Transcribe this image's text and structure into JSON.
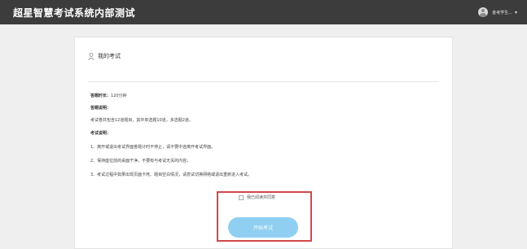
{
  "header": {
    "app_title": "超星智慧考试系统内部测试",
    "user_name": "金考学生...",
    "user_menu_icon": "chevron-down-icon",
    "avatar_icon": "user-avatar-icon"
  },
  "section": {
    "icon": "person-icon",
    "title": "我的考试"
  },
  "exam": {
    "duration_label": "答题时长：",
    "duration_value": "120分钟",
    "info_label": "答题说明：",
    "info_text": "考试卷共包含12道题目，其中单选题10道，多选题2道。",
    "notes_label": "考试说明：",
    "notes": [
      "1、离开或退出考试界面答题计时不停止，请不要中途离开考试界面。",
      "2、保持座位前的桌面干净，不要有与考试无关的内容。",
      "3、考试过程中如果出现页面卡死、题目空白情况，请尝试切换网络或退出重新进入考试。"
    ]
  },
  "agree": {
    "label": "我已阅读并同意",
    "checked": false
  },
  "start_button": {
    "label": "开始考试"
  },
  "colors": {
    "topbar": "#3c3c3c",
    "button": "#8fd0f2",
    "highlight_border": "#d24848"
  }
}
